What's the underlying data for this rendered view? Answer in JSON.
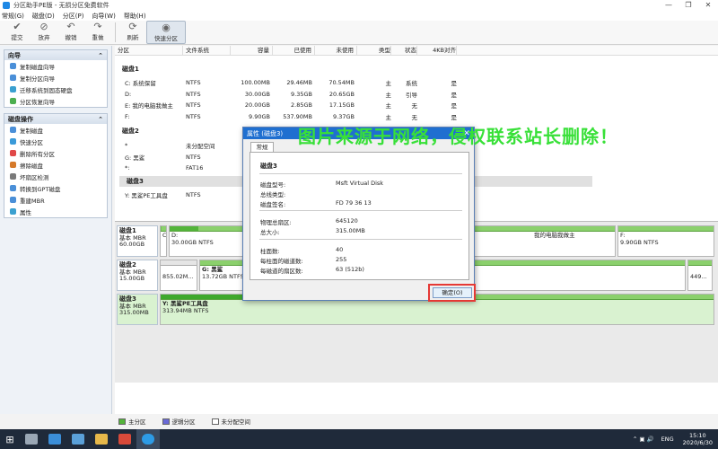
{
  "window": {
    "title": "分区助手PE版 - 无损分区免费软件",
    "controls": [
      "—",
      "❐",
      "✕"
    ]
  },
  "menu": [
    "常规(G)",
    "磁盘(D)",
    "分区(P)",
    "向导(W)",
    "帮助(H)"
  ],
  "toolbar": {
    "buttons": [
      {
        "label": "提交",
        "icon": "check-icon"
      },
      {
        "label": "放弃",
        "icon": "discard-icon"
      },
      {
        "label": "撤销",
        "icon": "undo-icon"
      },
      {
        "label": "重做",
        "icon": "redo-icon"
      }
    ],
    "refresh": "刷新",
    "quick_partition": "快速分区"
  },
  "sidebar": {
    "wizard_title": "向导",
    "wizard_items": [
      "复制磁盘向导",
      "复制分区向导",
      "迁移系统到固态硬盘",
      "分区恢复向导"
    ],
    "disk_ops_title": "磁盘操作",
    "disk_ops_items": [
      "复制磁盘",
      "快速分区",
      "删除所有分区",
      "擦除磁盘",
      "坏扇区检测",
      "转换到GPT磁盘",
      "重建MBR",
      "属性"
    ]
  },
  "table": {
    "headers": [
      "分区",
      "文件系统",
      "容量",
      "已使用",
      "未使用",
      "类型",
      "状态",
      "4KB对齐"
    ],
    "disk1": {
      "name": "磁盘1",
      "rows": [
        [
          "C: 系统保留",
          "NTFS",
          "100.00MB",
          "29.46MB",
          "70.54MB",
          "主",
          "系统",
          "是"
        ],
        [
          "D:",
          "NTFS",
          "30.00GB",
          "9.35GB",
          "20.65GB",
          "主",
          "引导",
          "是"
        ],
        [
          "E: 我的电脑我做主",
          "NTFS",
          "20.00GB",
          "2.85GB",
          "17.15GB",
          "主",
          "无",
          "是"
        ],
        [
          "F:",
          "NTFS",
          "9.90GB",
          "537.90MB",
          "9.37GB",
          "主",
          "无",
          "是"
        ]
      ]
    },
    "disk2": {
      "name": "磁盘2",
      "rows": [
        [
          "*",
          "未分配空间"
        ],
        [
          "G: 黑鲨",
          "NTFS"
        ],
        [
          "*:",
          "FAT16"
        ]
      ]
    },
    "disk3": {
      "name": "磁盘3",
      "rows": [
        [
          "Y: 黑鲨PE工具盘",
          "NTFS"
        ]
      ]
    }
  },
  "diskmap": {
    "disk1": {
      "name": "磁盘1",
      "type": "基本 MBR",
      "size": "60.00GB",
      "parts": [
        {
          "l1": "C",
          "l2": ""
        },
        {
          "l1": "D:",
          "l2": "30.00GB NTFS"
        },
        {
          "l1": "我的电脑我做主",
          "l2": ""
        },
        {
          "l1": "F:",
          "l2": "9.90GB NTFS"
        }
      ]
    },
    "disk2": {
      "name": "磁盘2",
      "type": "基本 MBR",
      "size": "15.00GB",
      "parts": [
        {
          "l1": "",
          "l2": "855.02M..."
        },
        {
          "l1": "G: 黑鲨",
          "l2": "13.72GB NTFS"
        },
        {
          "l1": "",
          "l2": "449..."
        }
      ]
    },
    "disk3": {
      "name": "磁盘3",
      "type": "基本 MBR",
      "size": "315.00MB",
      "parts": [
        {
          "l1": "Y: 黑鲨PE工具盘",
          "l2": "313.94MB NTFS"
        }
      ]
    }
  },
  "legend": [
    "主分区",
    "逻辑分区",
    "未分配空间"
  ],
  "taskbar": {
    "lang": "ENG",
    "time": "15:10",
    "date": "2020/6/30"
  },
  "dialog": {
    "title": "属性 (磁盘3)",
    "tab": "常规",
    "section": "磁盘3",
    "fields": [
      {
        "k": "磁盘型号:",
        "v": "Msft    Virtual Disk"
      },
      {
        "k": "总线类型:",
        "v": ""
      },
      {
        "k": "磁盘签名:",
        "v": "FD 79 36 13"
      },
      {
        "k": "物理总扇区:",
        "v": "645120"
      },
      {
        "k": "总大小:",
        "v": "315.00MB"
      },
      {
        "k": "柱面数:",
        "v": "40"
      },
      {
        "k": "每柱面的磁道数:",
        "v": "255"
      },
      {
        "k": "每磁道的扇区数:",
        "v": "63 (512b)"
      }
    ],
    "ok": "确定(O)"
  },
  "watermark": "图片来源于网络，侵权联系站长删除！"
}
